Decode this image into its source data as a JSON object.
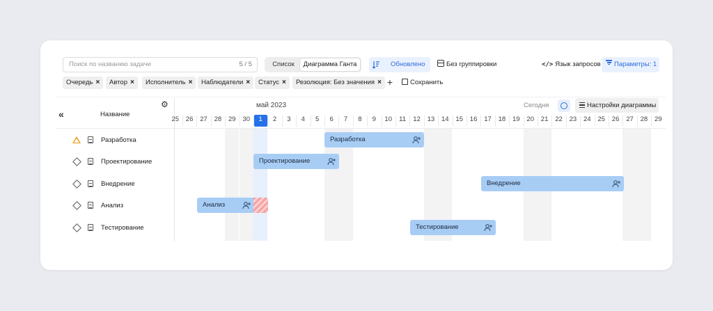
{
  "toolbar": {
    "search_placeholder": "Поиск по названию задачи",
    "search_count": "5 / 5",
    "view_list": "Список",
    "view_gantt": "Диаграмма Ганта",
    "sort_label": "Обновлено",
    "group_label": "Без группировки",
    "query_lang": "Язык запросов",
    "params": "Параметры: 1"
  },
  "filters": [
    "Очередь",
    "Автор",
    "Исполнитель",
    "Наблюдатели",
    "Статус",
    "Резолюция: Без значения"
  ],
  "filter_save": "Сохранить",
  "left_panel": {
    "column_title": "Название"
  },
  "gantt": {
    "month": "май 2023",
    "today_label": "Сегодня",
    "settings_label": "Настройки диаграммы",
    "days": [
      "25",
      "26",
      "27",
      "28",
      "29",
      "30",
      "1",
      "2",
      "3",
      "4",
      "5",
      "6",
      "7",
      "8",
      "9",
      "10",
      "11",
      "12",
      "13",
      "14",
      "15",
      "16",
      "17",
      "18",
      "19",
      "20",
      "21",
      "22",
      "23",
      "24",
      "25",
      "26",
      "27",
      "28",
      "29"
    ],
    "current_day": "1",
    "weekend_days": [
      "29",
      "30",
      "6",
      "7",
      "13",
      "14",
      "20",
      "21",
      "27",
      "28"
    ],
    "bar_color": "#a8cdf5",
    "accent": "#2572e8"
  },
  "tasks": [
    {
      "name": "Разработка",
      "icon": "warning-triangle",
      "start": "6",
      "end": "12"
    },
    {
      "name": "Проектирование",
      "icon": "diamond",
      "start": "1",
      "end": "6"
    },
    {
      "name": "Внедрение",
      "icon": "diamond",
      "start": "17",
      "end": "26"
    },
    {
      "name": "Анализ",
      "icon": "diamond",
      "start": "27",
      "end": "30",
      "overdue_into": "1"
    },
    {
      "name": "Тестирование",
      "icon": "diamond",
      "start": "12",
      "end": "17"
    }
  ]
}
